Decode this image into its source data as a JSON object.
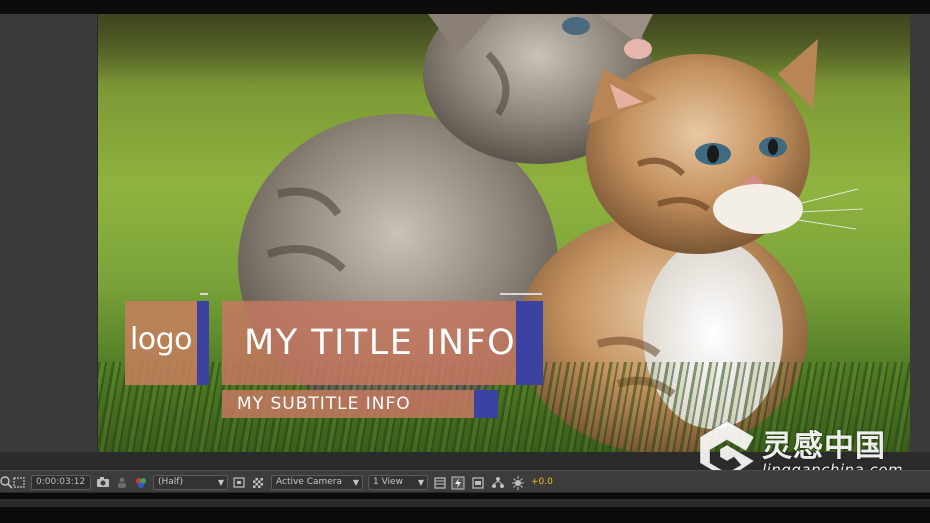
{
  "composition": {
    "logo_text": "logo",
    "title_text": "MY TITLE INFO",
    "subtitle_text": "MY SUBTITLE INFO",
    "accent_color": "#3b42a2",
    "panel_color": "#c4785f"
  },
  "watermark": {
    "chinese_text": "灵感中国",
    "english_text": "lingganchina.com"
  },
  "toolbar": {
    "timecode": "0:00:03:12",
    "resolution": "(Half)",
    "camera": "Active Camera",
    "views": "1 View",
    "exposure": "+0.0",
    "icons": [
      "magnifier-icon",
      "region-of-interest-icon",
      "camera-snapshot-icon",
      "show-snapshot-icon",
      "color-channels-icon",
      "toggle-mask-icon",
      "transparency-grid-icon",
      "layout-icon",
      "fast-preview-icon",
      "timeline-icon",
      "flowchart-icon",
      "exposure-icon"
    ]
  }
}
